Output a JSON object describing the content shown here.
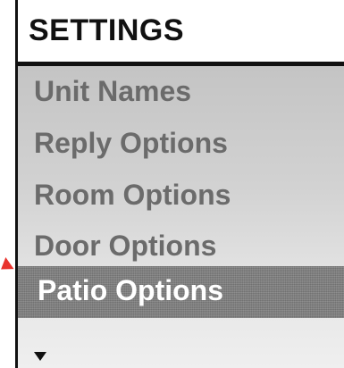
{
  "header": {
    "title": "SETTINGS"
  },
  "menu": {
    "items": [
      {
        "label": "Unit Names",
        "selected": false
      },
      {
        "label": "Reply Options",
        "selected": false
      },
      {
        "label": "Room Options",
        "selected": false
      },
      {
        "label": "Door Options",
        "selected": false
      },
      {
        "label": "Patio Options",
        "selected": true
      }
    ],
    "more_indicator_icon": "triangle-down-icon"
  },
  "colors": {
    "background": "#ffffff",
    "header_text": "#111111",
    "menu_text": "#6b6b6b",
    "selected_text": "#ffffff",
    "selected_bg": "#7e7e7e",
    "pointer": "#e8322c"
  }
}
